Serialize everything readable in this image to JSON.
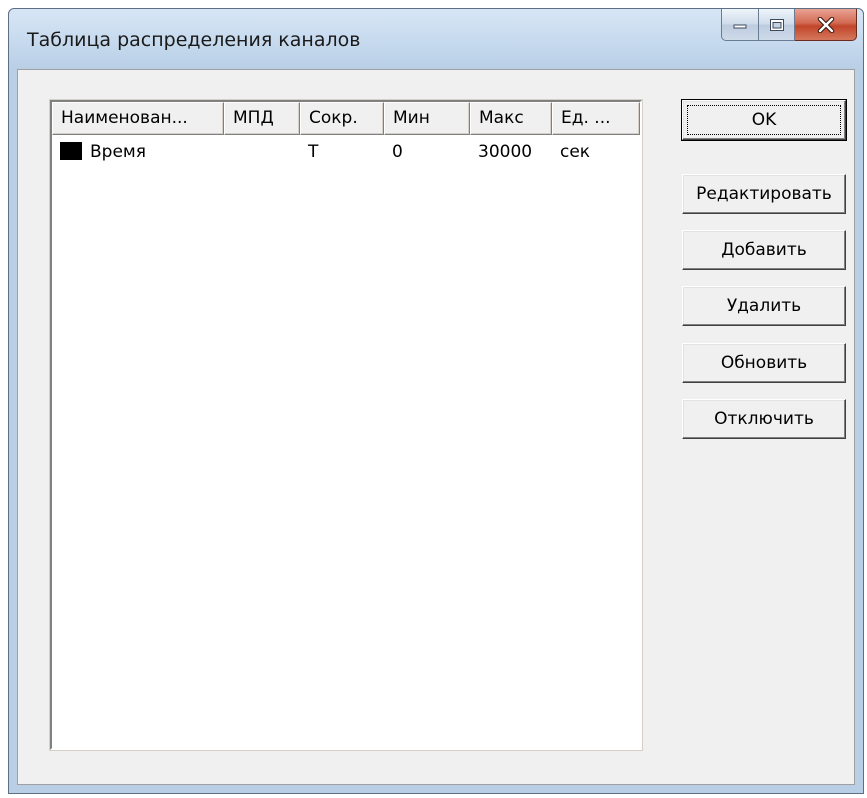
{
  "window": {
    "title": "Таблица распределения каналов"
  },
  "caption": {
    "minimize_icon": "minimize-icon",
    "maximize_icon": "maximize-icon",
    "close_icon": "close-icon"
  },
  "table": {
    "columns": [
      "Наименован...",
      "МПД",
      "Сокр.",
      "Мин",
      "Макс",
      "Ед. ..."
    ],
    "rows": [
      {
        "color": "#000000",
        "name": "Время",
        "mpd": "",
        "abbr": "Т",
        "min": "0",
        "max": "30000",
        "unit": "сек"
      }
    ]
  },
  "buttons": {
    "ok": "OK",
    "edit": "Редактировать",
    "add": "Добавить",
    "delete": "Удалить",
    "refresh": "Обновить",
    "disable": "Отключить"
  }
}
